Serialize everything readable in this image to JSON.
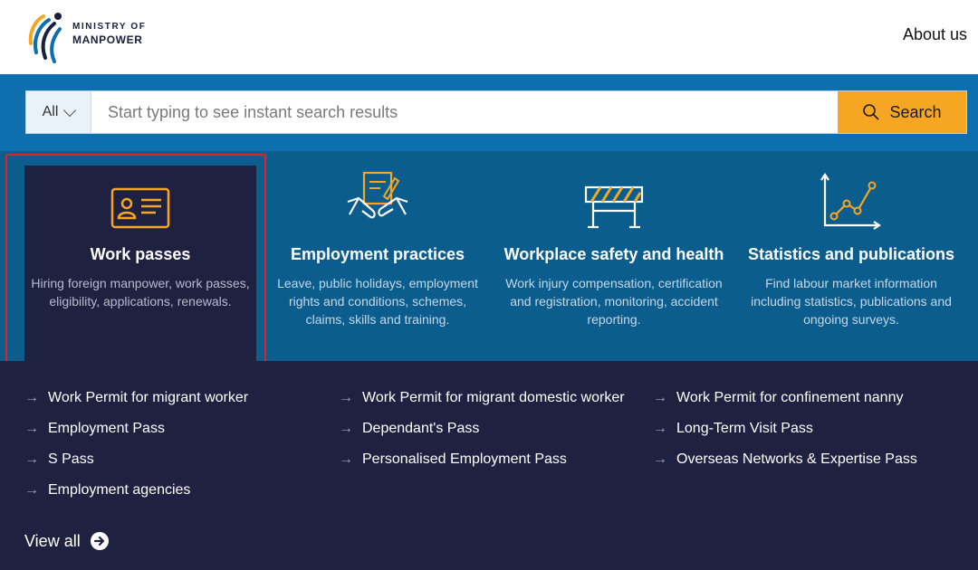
{
  "header": {
    "logo_line1": "MINISTRY OF",
    "logo_line2": "MANPOWER",
    "about": "About us"
  },
  "search": {
    "scope": "All",
    "placeholder": "Start typing to see instant search results",
    "button": "Search"
  },
  "categories": [
    {
      "title": "Work passes",
      "desc": "Hiring foreign manpower, work passes, eligibility, applications, renewals.",
      "icon": "id-card-icon"
    },
    {
      "title": "Employment practices",
      "desc": "Leave, public holidays, employment rights and conditions, schemes, claims, skills and training.",
      "icon": "handshake-icon"
    },
    {
      "title": "Workplace safety and health",
      "desc": "Work injury compensation, certification and registration, monitoring, accident reporting.",
      "icon": "barrier-icon"
    },
    {
      "title": "Statistics and publications",
      "desc": "Find labour market information including statistics, publications and ongoing surveys.",
      "icon": "line-chart-icon"
    }
  ],
  "links": [
    [
      "Work Permit for migrant worker",
      "Employment Pass",
      "S Pass",
      "Employment agencies"
    ],
    [
      "Work Permit for migrant domestic worker",
      "Dependant's Pass",
      "Personalised Employment Pass"
    ],
    [
      "Work Permit for confinement nanny",
      "Long-Term Visit Pass",
      "Overseas Networks & Expertise Pass"
    ]
  ],
  "arrow_glyph": "→",
  "view_all": "View all",
  "colors": {
    "accent_orange": "#f6a623",
    "blue_band": "#0d6fae",
    "dark_navy": "#1e2240",
    "highlight_red": "#e02424"
  }
}
